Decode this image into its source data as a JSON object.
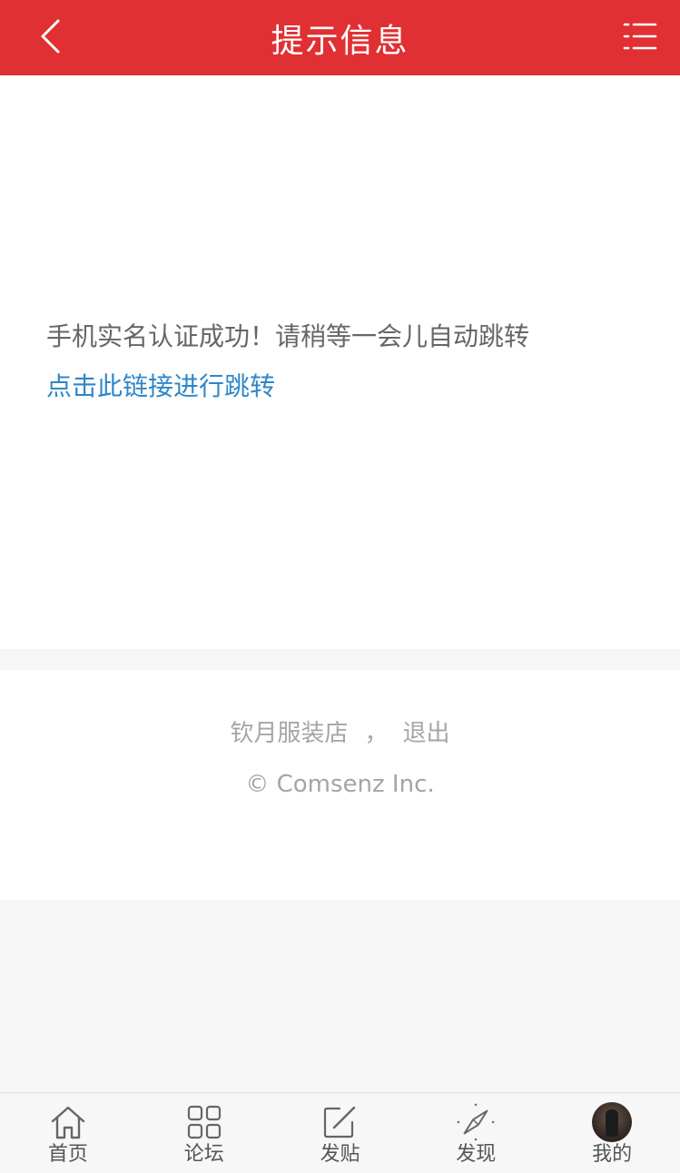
{
  "header": {
    "title": "提示信息",
    "back_icon": "chevron-left-icon",
    "menu_icon": "list-menu-icon",
    "bg_color": "#e03033"
  },
  "message": {
    "text": "手机实名认证成功！请稍等一会儿自动跳转",
    "link": "点击此链接进行跳转",
    "link_color": "#2f86c8"
  },
  "footer": {
    "shop_name": "钦月服装店",
    "separator": "，",
    "logout": "退出",
    "copyright": "© Comsenz Inc."
  },
  "tabbar": {
    "tabs": [
      {
        "label": "首页",
        "icon": "home-icon"
      },
      {
        "label": "论坛",
        "icon": "grid-icon"
      },
      {
        "label": "发贴",
        "icon": "compose-icon"
      },
      {
        "label": "发现",
        "icon": "compass-icon"
      },
      {
        "label": "我的",
        "icon": "avatar"
      }
    ]
  }
}
